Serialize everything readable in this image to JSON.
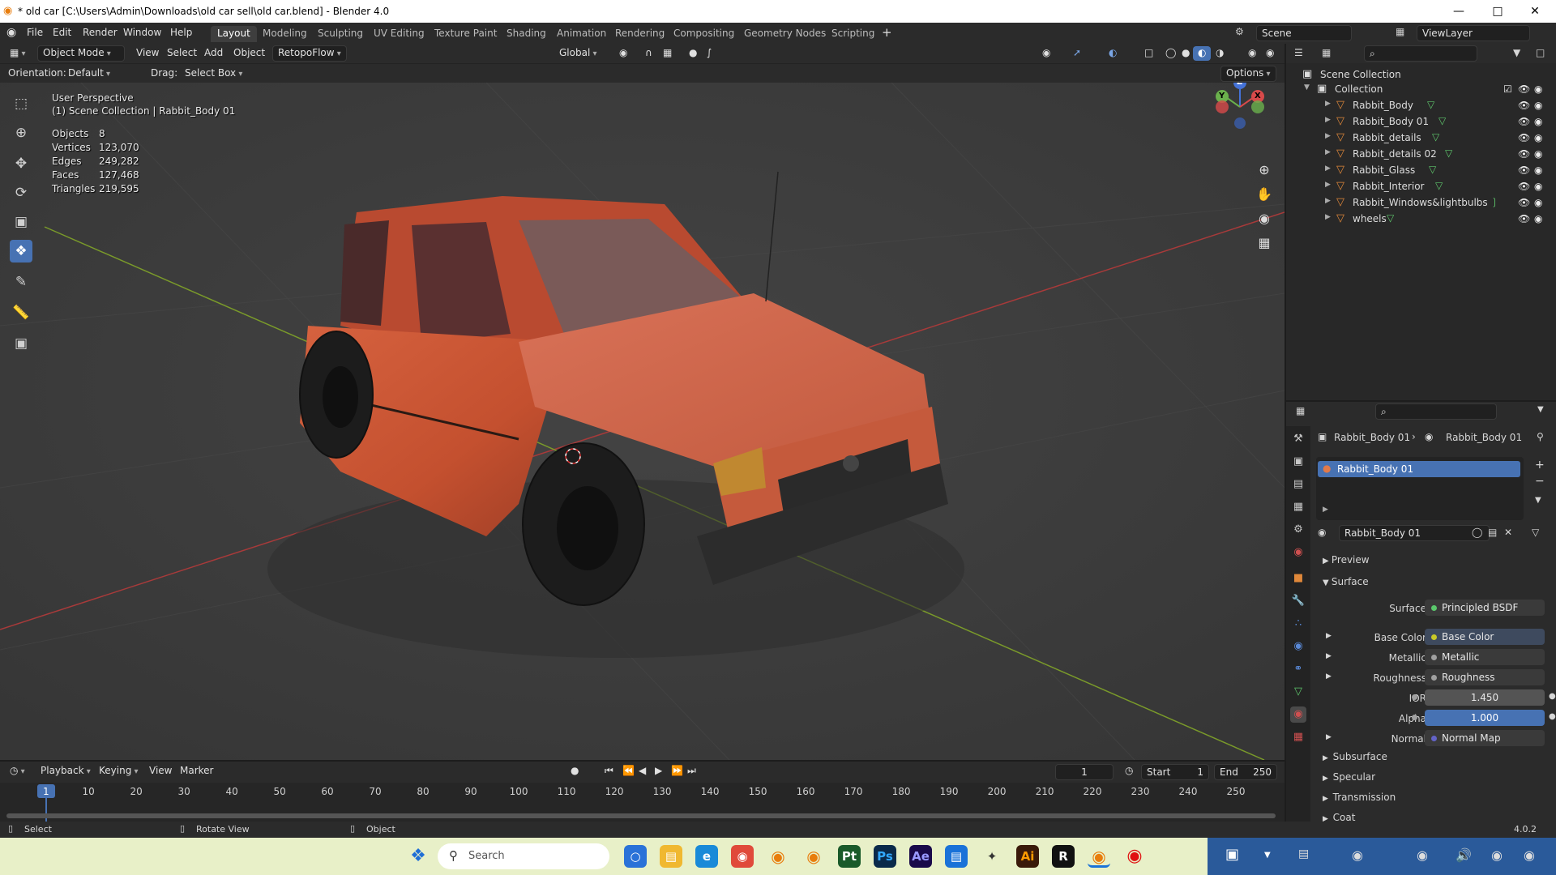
{
  "window": {
    "title": "* old car [C:\\Users\\Admin\\Downloads\\old car sell\\old car.blend] - Blender 4.0"
  },
  "menus": [
    "File",
    "Edit",
    "Render",
    "Window",
    "Help"
  ],
  "workspaces": [
    "Layout",
    "Modeling",
    "Sculpting",
    "UV Editing",
    "Texture Paint",
    "Shading",
    "Animation",
    "Rendering",
    "Compositing",
    "Geometry Nodes",
    "Scripting"
  ],
  "active_workspace": "Layout",
  "scene": {
    "label": "Scene",
    "view_layer": "ViewLayer"
  },
  "viewport_header": {
    "mode": "Object Mode",
    "items": [
      "View",
      "Select",
      "Add",
      "Object"
    ],
    "addon": "RetopoFlow",
    "transform": "Global",
    "orientation_label": "Orientation:",
    "orientation_value": "Default",
    "drag_label": "Drag:",
    "drag_value": "Select Box",
    "options": "Options"
  },
  "overlay": {
    "perspective": "User Perspective",
    "collection": "(1) Scene Collection | Rabbit_Body 01"
  },
  "stats": [
    {
      "label": "Objects",
      "value": "8"
    },
    {
      "label": "Vertices",
      "value": "123,070"
    },
    {
      "label": "Edges",
      "value": "249,282"
    },
    {
      "label": "Faces",
      "value": "127,468"
    },
    {
      "label": "Triangles",
      "value": "219,595"
    }
  ],
  "gizmo": {
    "z": "Z",
    "y": "Y",
    "x": "X"
  },
  "outliner": {
    "root": "Scene Collection",
    "collection": "Collection",
    "objects": [
      "Rabbit_Body",
      "Rabbit_Body 01",
      "Rabbit_details",
      "Rabbit_details 02",
      "Rabbit_Glass",
      "Rabbit_Interior",
      "Rabbit_Windows&lightbulbs",
      "wheels"
    ]
  },
  "properties": {
    "breadcrumb_obj": "Rabbit_Body 01",
    "breadcrumb_mat": "Rabbit_Body 01",
    "slot": "Rabbit_Body 01",
    "material": "Rabbit_Body 01",
    "sections": {
      "preview": "Preview",
      "surface": "Surface",
      "subsurface": "Subsurface",
      "specular": "Specular",
      "transmission": "Transmission",
      "coat": "Coat"
    },
    "rows": [
      {
        "label": "Surface",
        "value": "Principled BSDF",
        "dot": "#5ac86c"
      },
      {
        "label": "Base Color",
        "value": "Base Color",
        "dot": "#c8c828"
      },
      {
        "label": "Metallic",
        "value": "Metallic",
        "dot": "#a0a0a0"
      },
      {
        "label": "Roughness",
        "value": "Roughness",
        "dot": "#a0a0a0"
      },
      {
        "label": "IOR",
        "value": "1.450",
        "dot": "#a0a0a0"
      },
      {
        "label": "Alpha",
        "value": "1.000",
        "dot": "#a0a0a0"
      },
      {
        "label": "Normal",
        "value": "Normal Map",
        "dot": "#6363c7"
      }
    ]
  },
  "timeline": {
    "menus": [
      "Playback",
      "Keying",
      "View",
      "Marker"
    ],
    "current_frame": "1",
    "start_label": "Start",
    "start": "1",
    "end_label": "End",
    "end": "250",
    "ticks": [
      "1",
      "10",
      "20",
      "30",
      "40",
      "50",
      "60",
      "70",
      "80",
      "90",
      "100",
      "110",
      "120",
      "130",
      "140",
      "150",
      "160",
      "170",
      "180",
      "190",
      "200",
      "210",
      "220",
      "230",
      "240",
      "250"
    ]
  },
  "statusbar": {
    "select": "Select",
    "rotate": "Rotate View",
    "object": "Object",
    "version": "4.0.2"
  },
  "taskbar": {
    "search": "Search"
  },
  "colors": {
    "accent": "#4772b3",
    "car_body": "#c9543a",
    "grid_red": "#a83a3a",
    "grid_green": "#7a9a2a"
  }
}
